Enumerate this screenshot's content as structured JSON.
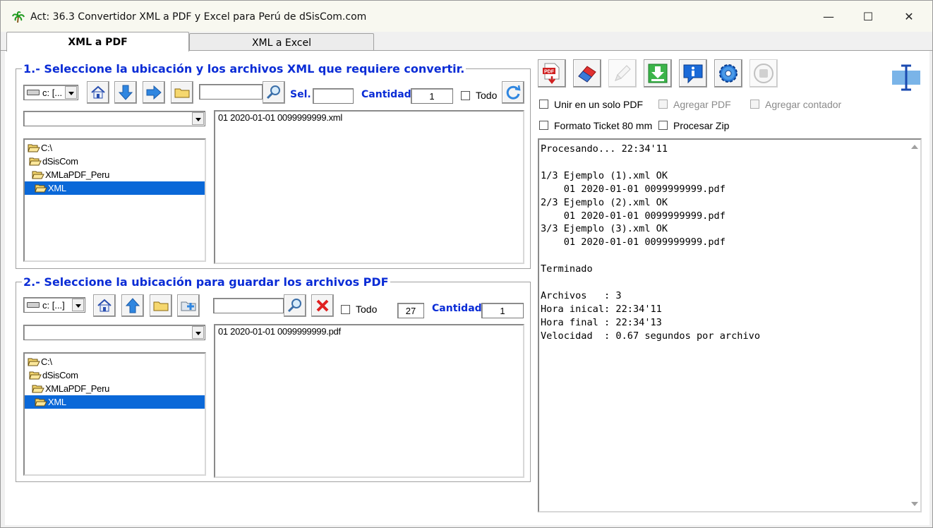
{
  "window": {
    "title": "Act: 36.3  Convertidor XML a PDF y Excel para Perú de dSisCom.com",
    "minimize": "—",
    "maximize": "☐",
    "close": "✕"
  },
  "tabs": [
    {
      "label": "XML a PDF",
      "active": true
    },
    {
      "label": "XML a Excel",
      "active": false
    }
  ],
  "section1": {
    "title": "1.- Seleccione la ubicación y los archivos XML que requiere convertir.",
    "drive": "c: [...",
    "search_value": "",
    "sel_label": "Sel.",
    "sel_value": "",
    "cantidad_label": "Cantidad",
    "cantidad_value": "1",
    "todo_label": "Todo",
    "folder_combo": "",
    "tree": [
      "C:\\",
      "dSisCom",
      "XMLaPDF_Peru",
      "XML"
    ],
    "files": [
      "01 2020-01-01 0099999999.xml"
    ]
  },
  "section2": {
    "title": "2.- Seleccione la ubicación para guardar los archivos PDF",
    "drive": "c: [...]",
    "search_value": "",
    "todo_label": "Todo",
    "count_value": "27",
    "cantidad_label": "Cantidad",
    "cantidad_value": "1",
    "folder_combo": "",
    "tree": [
      "C:\\",
      "dSisCom",
      "XMLaPDF_Peru",
      "XML"
    ],
    "files": [
      "01 2020-01-01 0099999999.pdf"
    ]
  },
  "options": {
    "unir_pdf": "Unir en un solo PDF",
    "agregar_pdf": "Agregar PDF",
    "agregar_contador": "Agregar contador",
    "formato_ticket": "Formato Ticket 80 mm",
    "procesar_zip": "Procesar Zip"
  },
  "toolbar_icons": [
    "pdf-convert-icon",
    "eraser-icon",
    "pencil-icon",
    "download-icon",
    "info-icon",
    "settings-icon",
    "stop-icon"
  ],
  "log": {
    "lines": [
      "Procesando... 22:34'11",
      "",
      "1/3 Ejemplo (1).xml OK",
      "    01 2020-01-01 0099999999.pdf",
      "2/3 Ejemplo (2).xml OK",
      "    01 2020-01-01 0099999999.pdf",
      "3/3 Ejemplo (3).xml OK",
      "    01 2020-01-01 0099999999.pdf",
      "",
      "Terminado",
      "",
      "Archivos   : 3",
      "Hora inical: 22:34'11",
      "Hora final : 22:34'13",
      "Velocidad  : 0.67 segundos por archivo"
    ]
  },
  "colors": {
    "accent_blue": "#0a2cd6",
    "selection": "#0a68d8"
  }
}
